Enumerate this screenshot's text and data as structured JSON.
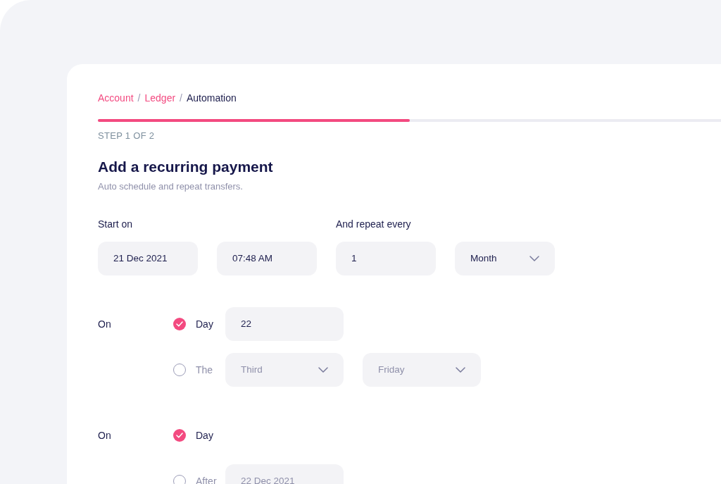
{
  "breadcrumb": [
    {
      "kind": "link",
      "label": "Account",
      "current": false
    },
    {
      "kind": "separator",
      "label": "/"
    },
    {
      "kind": "link",
      "label": "Ledger",
      "current": false
    },
    {
      "kind": "separator",
      "label": "/"
    },
    {
      "kind": "link",
      "label": "Automation",
      "current": true
    }
  ],
  "progress": {
    "level": 0.5
  },
  "step": "STEP 1 OF 2",
  "title": "Add a recurring payment",
  "subtitle": "Auto schedule and repeat transfers.",
  "schedule": [
    {
      "label": "Start on",
      "fields": [
        {
          "kind": "input",
          "value": "21 Dec 2021"
        },
        {
          "kind": "input",
          "value": "07:48 AM"
        }
      ]
    },
    {
      "label": "And repeat every",
      "fields": [
        {
          "kind": "input",
          "value": "1"
        },
        {
          "kind": "select",
          "value": "Month"
        }
      ]
    }
  ],
  "groups": [
    {
      "label": "On",
      "options": [
        {
          "label": "Day",
          "selected": true,
          "fields": [
            {
              "kind": "input",
              "value": "22"
            }
          ]
        },
        {
          "label": "The",
          "selected": false,
          "fields": [
            {
              "kind": "select",
              "value": "Third"
            },
            {
              "kind": "select",
              "value": "Friday"
            }
          ]
        }
      ]
    },
    {
      "label": "On",
      "options": [
        {
          "label": "Day",
          "selected": true
        },
        {
          "label": "After",
          "selected": false,
          "fields": [
            {
              "kind": "input",
              "value": "22 Dec 2021"
            }
          ]
        }
      ]
    }
  ]
}
